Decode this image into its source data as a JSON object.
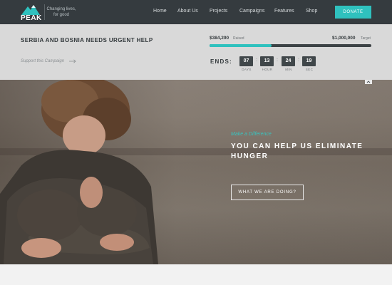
{
  "header": {
    "logo_text": "PEAK",
    "tagline": "Changing lives, for good",
    "nav": [
      "Home",
      "About Us",
      "Projects",
      "Campaigns",
      "Features",
      "Shop"
    ],
    "donate_label": "DONATE"
  },
  "campaign": {
    "title": "SERBIA AND BOSNIA NEEDS URGENT HELP",
    "support_link": "Support this Campaign",
    "raised_amount": "$384,290",
    "raised_label": "Raised",
    "target_amount": "$1,000,000",
    "target_label": "Target",
    "progress_fraction": 0.384,
    "ends_label": "ENDS:",
    "countdown": [
      {
        "value": "07",
        "unit": "DAYS"
      },
      {
        "value": "13",
        "unit": "HOUR"
      },
      {
        "value": "24",
        "unit": "MIN"
      },
      {
        "value": "19",
        "unit": "SEC"
      }
    ]
  },
  "hero": {
    "kicker": "Make a Difference",
    "title": "YOU CAN HELP US ELIMINATE HUNGER",
    "button_label": "WHAT WE ARE DOING?"
  },
  "colors": {
    "accent": "#2fc1be",
    "header_bg": "#353b3f",
    "campaign_bg": "#d9d9d9"
  },
  "icons": {
    "logo": "mountain-icon",
    "support_arrow": "arrow-right-icon",
    "collapse": "chevron-up-icon"
  }
}
